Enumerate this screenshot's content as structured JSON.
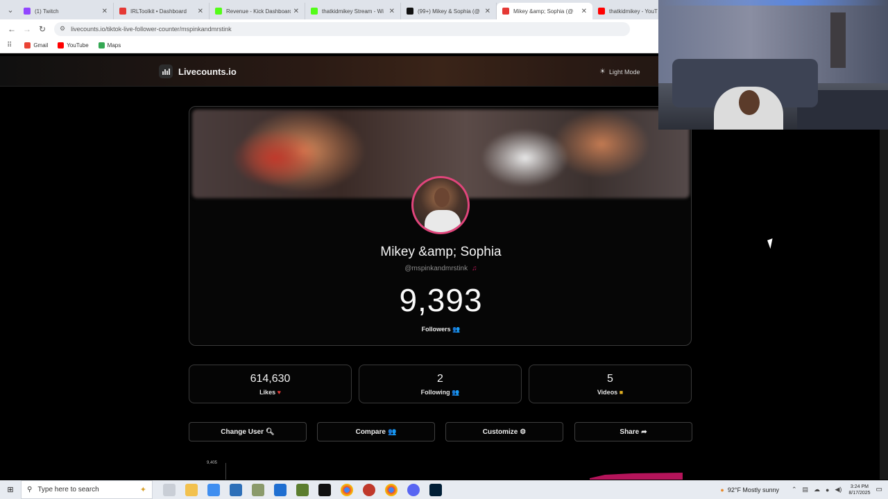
{
  "browser": {
    "tabs": [
      {
        "title": "(1) Twitch",
        "color": "#9146ff",
        "active": false
      },
      {
        "title": "IRLToolkit • Dashboard",
        "color": "#e53935",
        "active": false
      },
      {
        "title": "Revenue - Kick Dashboard",
        "color": "#53fc18",
        "active": false
      },
      {
        "title": "thatkidmikey Stream - Wi",
        "color": "#53fc18",
        "active": false
      },
      {
        "title": "(99+) Mikey & Sophia (@",
        "color": "#111111",
        "active": false
      },
      {
        "title": "Mikey &amp; Sophia (@",
        "color": "#e53935",
        "active": true
      },
      {
        "title": "thatkidmikey - YouT",
        "color": "#ff0000",
        "active": false
      }
    ],
    "url": "livecounts.io/tiktok-live-follower-counter/mspinkandmrstink",
    "bookmarks": [
      {
        "label": "Gmail",
        "color": "#ea4335"
      },
      {
        "label": "YouTube",
        "color": "#ff0000"
      },
      {
        "label": "Maps",
        "color": "#34a853"
      }
    ]
  },
  "site": {
    "brand": "Livecounts.io",
    "light_mode_label": "Light Mode"
  },
  "profile": {
    "display_name": "Mikey &amp; Sophia",
    "handle": "@mspinkandmrstink",
    "followers": "9,393",
    "followers_label": "Followers"
  },
  "stats": [
    {
      "value": "614,630",
      "label": "Likes",
      "icon": "heart-icon"
    },
    {
      "value": "2",
      "label": "Following",
      "icon": "users-icon"
    },
    {
      "value": "5",
      "label": "Videos",
      "icon": "video-icon"
    }
  ],
  "actions": [
    {
      "label": "Change User",
      "icon": "search-icon"
    },
    {
      "label": "Compare",
      "icon": "users-icon"
    },
    {
      "label": "Customize",
      "icon": "gear-icon"
    },
    {
      "label": "Share",
      "icon": "share-icon"
    }
  ],
  "chart": {
    "y_max_label": "9,405"
  },
  "taskbar": {
    "search_placeholder": "Type here to search",
    "weather": "92°F  Mostly sunny",
    "time": "3:24 PM",
    "date": "8/17/2025"
  }
}
